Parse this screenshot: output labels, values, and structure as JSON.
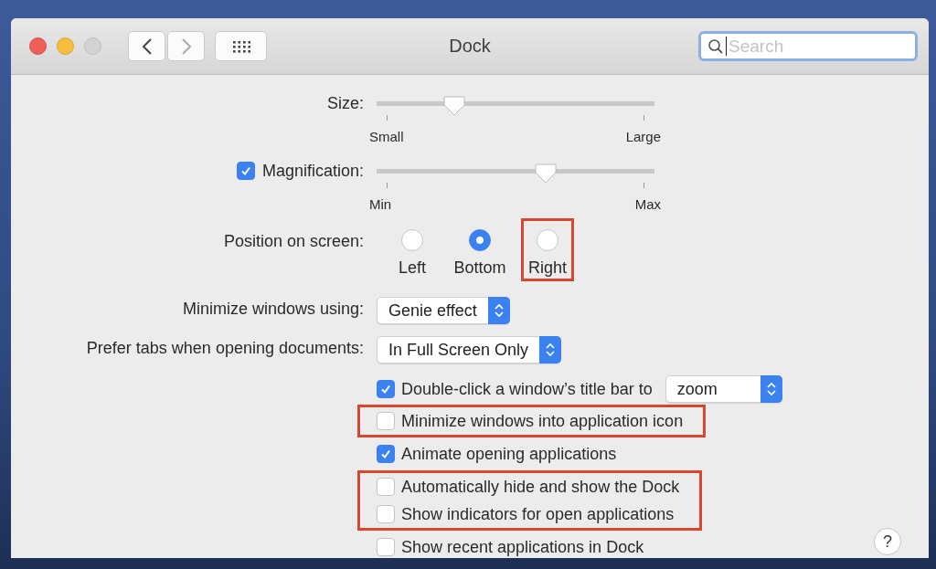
{
  "window": {
    "title": "Dock"
  },
  "search": {
    "placeholder": "Search",
    "focused": true
  },
  "size": {
    "label": "Size:",
    "level": 0.28,
    "min_label": "Small",
    "max_label": "Large"
  },
  "magnification": {
    "label": "Magnification:",
    "checked": true,
    "level": 0.61,
    "min_label": "Min",
    "max_label": "Max"
  },
  "position": {
    "label": "Position on screen:",
    "options": [
      {
        "label": "Left",
        "selected": false,
        "highlighted": false
      },
      {
        "label": "Bottom",
        "selected": true,
        "highlighted": false
      },
      {
        "label": "Right",
        "selected": false,
        "highlighted": true
      }
    ]
  },
  "minimize_using": {
    "label": "Minimize windows using:",
    "value": "Genie effect"
  },
  "prefer_tabs": {
    "label": "Prefer tabs when opening documents:",
    "value": "In Full Screen Only"
  },
  "double_click": {
    "label": "Double-click a window’s title bar to",
    "checked": true,
    "value": "zoom"
  },
  "checkboxes": [
    {
      "label": "Minimize windows into application icon",
      "checked": false,
      "highlighted": true
    },
    {
      "label": "Animate opening applications",
      "checked": true,
      "highlighted": false
    },
    {
      "label": "Automatically hide and show the Dock",
      "checked": false,
      "highlighted": true
    },
    {
      "label": "Show indicators for open applications",
      "checked": false,
      "highlighted": true
    },
    {
      "label": "Show recent applications in Dock",
      "checked": false,
      "highlighted": false
    }
  ],
  "help": {
    "label": "?"
  }
}
